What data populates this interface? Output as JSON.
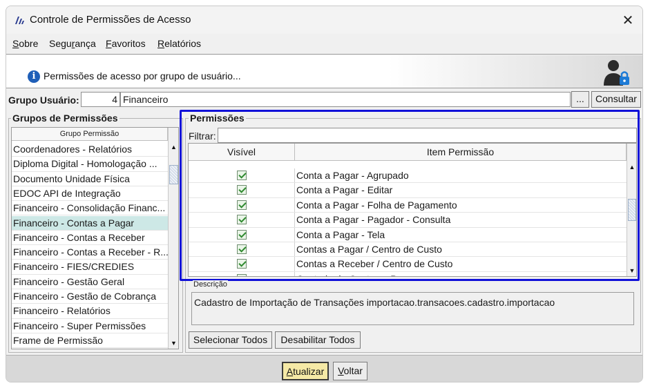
{
  "window": {
    "title": "Controle de Permissões de Acesso",
    "close_glyph": "✕"
  },
  "menu": [
    "Sobre",
    "Segurança",
    "Favoritos",
    "Relatórios"
  ],
  "banner": {
    "info_glyph": "i",
    "text": "Permissões de acesso por grupo de usuário..."
  },
  "group_user": {
    "label": "Grupo Usuário:",
    "code": "4",
    "name": "Financeiro",
    "lookup_label": "...",
    "consult_label": "Consultar"
  },
  "groups_panel": {
    "title": "Grupos de Permissões",
    "column": "Grupo Permissão",
    "items": [
      "Coordenadores - Relatórios",
      "Diploma Digital - Homologação ...",
      "Documento Unidade Física",
      "EDOC API de Integração",
      "Financeiro - Consolidação Financ...",
      "Financeiro - Contas a Pagar",
      "Financeiro - Contas a Receber",
      "Financeiro - Contas a Receber - R...",
      "Financeiro - FIES/CREDIES",
      "Financeiro - Gestão Geral",
      "Financeiro - Gestão de Cobrança",
      "Financeiro - Relatórios",
      "Financeiro - Super Permissões",
      "Frame de Permissão"
    ],
    "selected_index": 5
  },
  "permissions_panel": {
    "title": "Permissões",
    "filter_label": "Filtrar:",
    "filter_value": "",
    "columns": [
      "Visível",
      "Item Permissão"
    ],
    "rows": [
      {
        "visible": true,
        "item": "Conta a Pagar - Agrupado"
      },
      {
        "visible": true,
        "item": "Conta a Pagar - Editar"
      },
      {
        "visible": true,
        "item": "Conta a Pagar - Folha de Pagamento"
      },
      {
        "visible": true,
        "item": "Conta a Pagar - Pagador - Consulta"
      },
      {
        "visible": true,
        "item": "Conta a Pagar - Tela"
      },
      {
        "visible": true,
        "item": "Contas a Pagar / Centro de Custo"
      },
      {
        "visible": true,
        "item": "Contas a Receber / Centro de Custo"
      },
      {
        "visible": true,
        "item": "Controle de Contas a Pagar"
      }
    ]
  },
  "description": {
    "label": "Descrição",
    "text": "Cadastro de Importação de Transações importacao.transacoes.cadastro.importacao"
  },
  "actions": {
    "select_all": "Selecionar Todos",
    "disable_all": "Desabilitar Todos",
    "update": "Atualizar",
    "back": "Voltar"
  },
  "scroll_glyphs": {
    "up": "▲",
    "down": "▼"
  },
  "colors": {
    "highlight_border": "#1010d8",
    "selected_row": "#cde8e6",
    "check_green": "#2f8a2f",
    "info_blue": "#1f5fb8",
    "update_button": "#f5e9a6"
  }
}
